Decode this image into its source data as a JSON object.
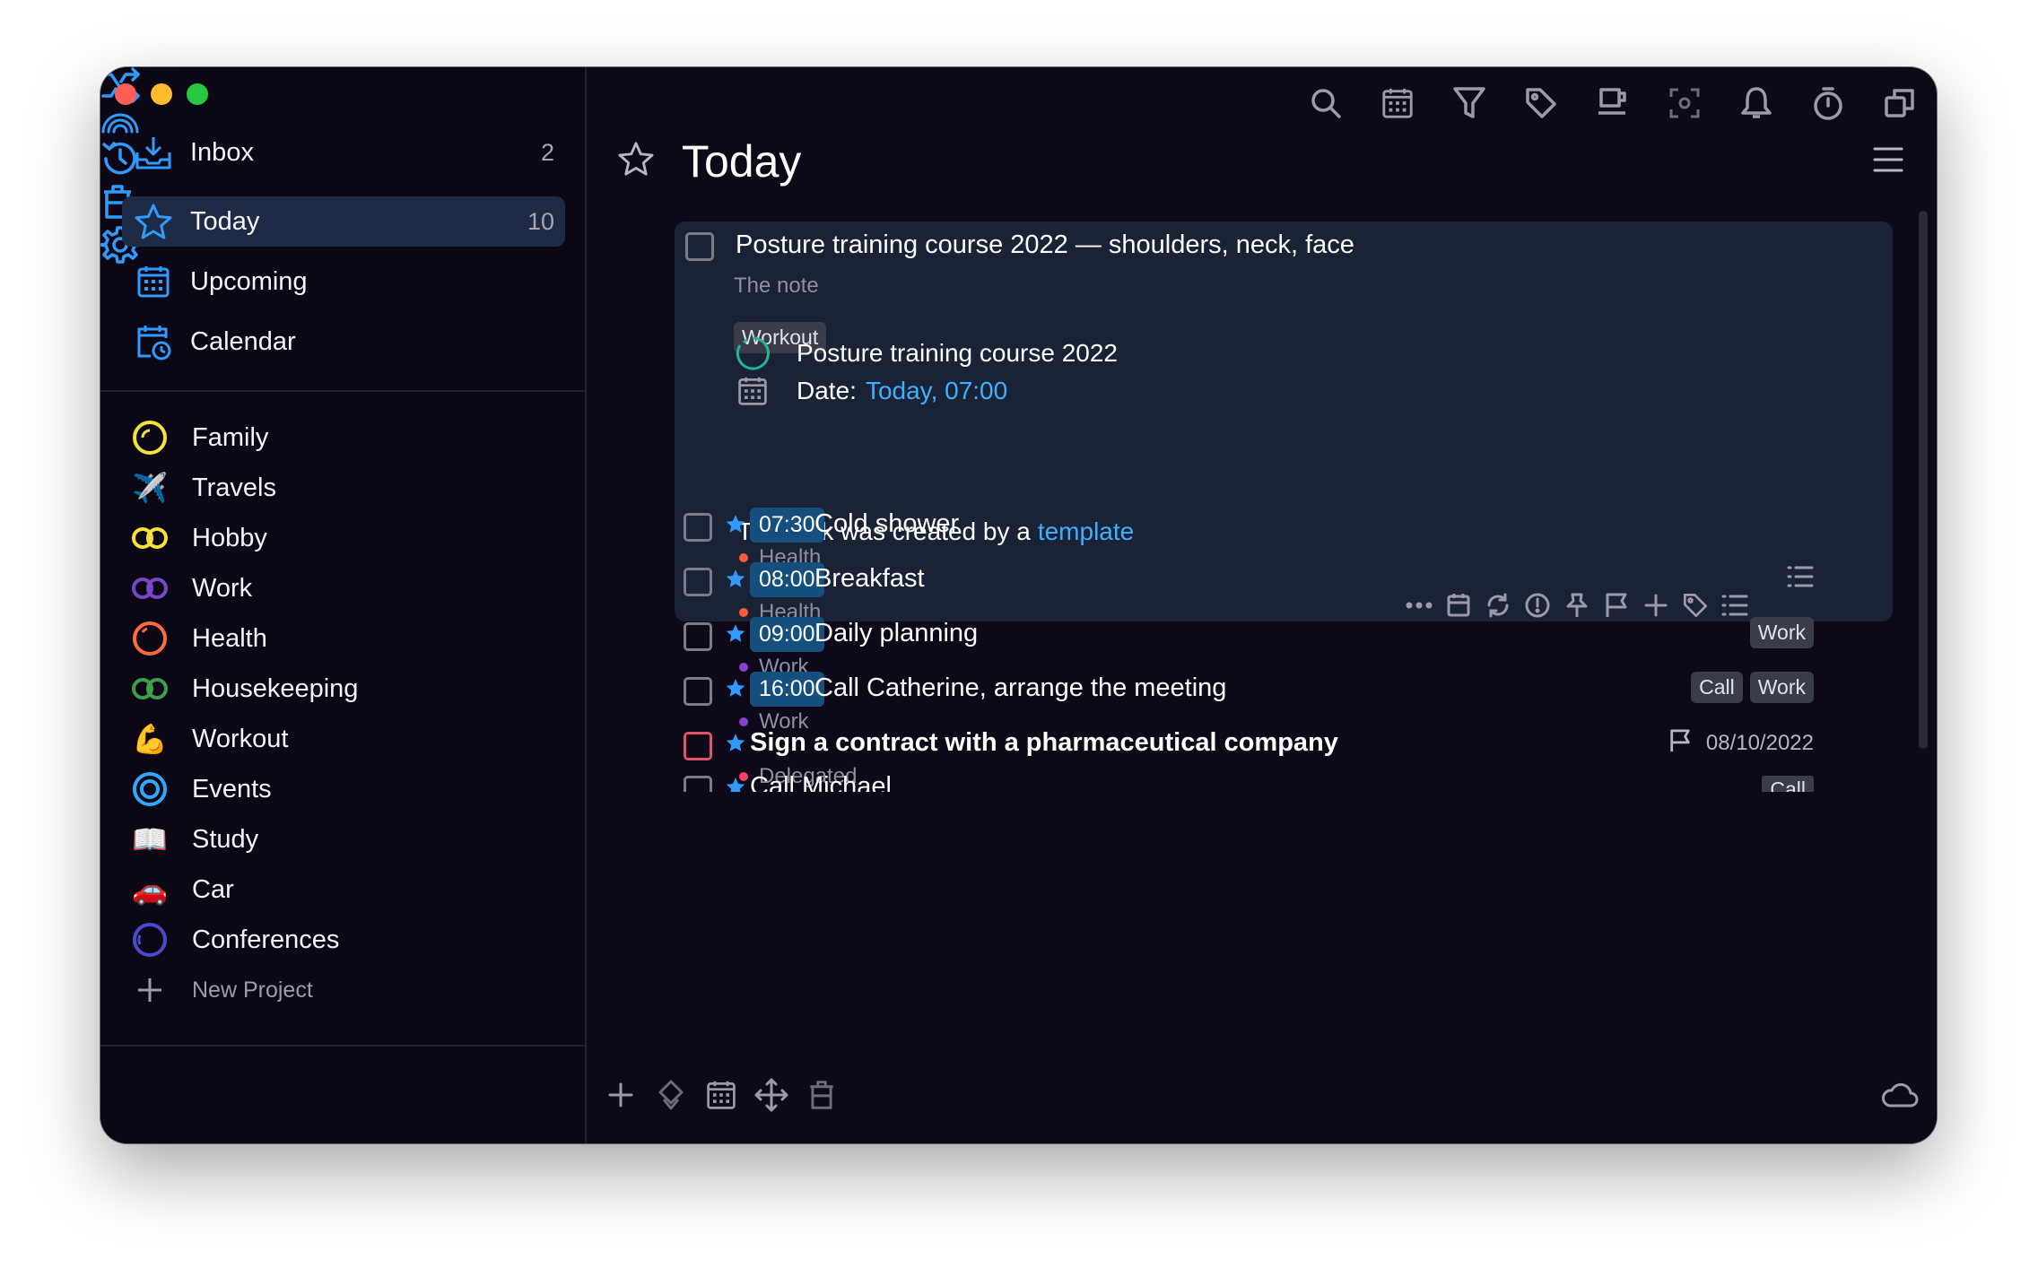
{
  "sidebar": {
    "nav": [
      {
        "label": "Inbox",
        "count": "2",
        "icon": "inbox-icon"
      },
      {
        "label": "Today",
        "count": "10",
        "icon": "star-icon"
      },
      {
        "label": "Upcoming",
        "count": "",
        "icon": "upcoming-calendar-icon"
      },
      {
        "label": "Calendar",
        "count": "",
        "icon": "calendar-clock-icon"
      }
    ],
    "projects": [
      {
        "label": "Family",
        "icon": "yellow-circle-icon",
        "color": "#f5e13c"
      },
      {
        "label": "Travels",
        "icon": "airplane-icon",
        "color": "#9ec7ff"
      },
      {
        "label": "Hobby",
        "icon": "yellow-rings-icon",
        "color": "#f5e13c"
      },
      {
        "label": "Work",
        "icon": "purple-rings-icon",
        "color": "#7a46c9"
      },
      {
        "label": "Health",
        "icon": "orange-circle-icon",
        "color": "#ff6a3d"
      },
      {
        "label": "Housekeeping",
        "icon": "green-rings-icon",
        "color": "#3c9e4a"
      },
      {
        "label": "Workout",
        "icon": "flexed-biceps-icon",
        "color": "#f5b73c"
      },
      {
        "label": "Events",
        "icon": "blue-target-icon",
        "color": "#2fa7ff"
      },
      {
        "label": "Study",
        "icon": "open-book-icon",
        "color": "#d8d8e0"
      },
      {
        "label": "Car",
        "icon": "red-car-icon",
        "color": "#e0363c"
      },
      {
        "label": "Conferences",
        "icon": "indigo-circle-icon",
        "color": "#4a4ad0"
      }
    ],
    "new_project": "New Project",
    "bottom_icons": [
      "shuffle-icon",
      "rainbow-icon",
      "history-icon",
      "trash-icon",
      "settings-gear-icon"
    ]
  },
  "toolbar": {
    "icons": [
      "search-icon",
      "calendar-icon",
      "filter-icon",
      "tag-icon",
      "coffee-cup-icon",
      "focus-icon",
      "bell-icon",
      "timer-icon",
      "windows-icon"
    ]
  },
  "main": {
    "title": "Today",
    "card": {
      "title": "Posture training course 2022 — shoulders, neck, face",
      "note": "The note",
      "tag": "Workout",
      "project_line": "Posture training course 2022",
      "date_label": "Date:",
      "date_value": "Today, 07:00",
      "created_text": "The task was created by a",
      "created_link": "template"
    },
    "tasks": [
      {
        "time": "07:30",
        "title": "Cold shower",
        "project": "Health",
        "project_color": "#ff5a3c",
        "tags": [],
        "checklist": false
      },
      {
        "time": "08:00",
        "title": "Breakfast",
        "project": "Health",
        "project_color": "#ff5a3c",
        "tags": [],
        "checklist": true
      },
      {
        "time": "09:00",
        "title": "Daily planning",
        "project": "Work",
        "project_color": "#8a3fd1",
        "tags": [
          "Work"
        ],
        "checklist": false
      },
      {
        "time": "16:00",
        "title": "Call Catherine, arrange the meeting",
        "project": "Work",
        "project_color": "#8a3fd1",
        "tags": [
          "Call",
          "Work"
        ],
        "checklist": false
      },
      {
        "time": "",
        "title": "Sign a contract with a pharmaceutical company",
        "project": "Delegated",
        "project_color": "#ff3c6a",
        "due": "08/10/2022",
        "tags": [],
        "checklist": false
      },
      {
        "time": "",
        "title": "Call Michael",
        "project": "",
        "tags": [
          "Call"
        ],
        "checklist": false
      }
    ]
  },
  "bottom_bar": {
    "icons": [
      "add-icon",
      "move-priority-icon",
      "date-icon",
      "move-arrows-icon",
      "delete-icon",
      "cloud-sync-icon"
    ]
  },
  "colors": {
    "accent": "#2f9bff",
    "background": "#0d0918",
    "card": "#1a2235",
    "time_badge": "#144f7e"
  }
}
